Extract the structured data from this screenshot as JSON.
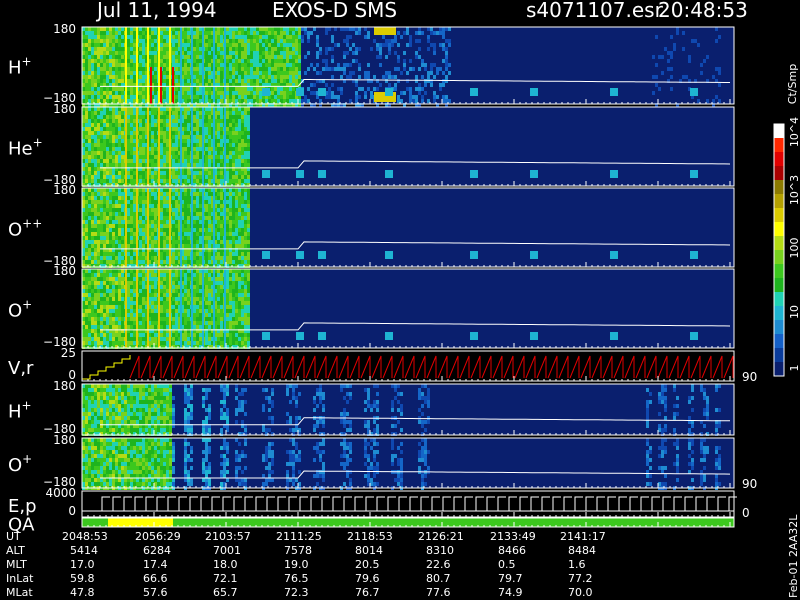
{
  "header": {
    "date": "Jul 11, 1994",
    "instrument": "EXOS-D SMS",
    "file": "s4071107.esr",
    "time": "20:48:53"
  },
  "colorbar": {
    "unit_label": "Ct/Smp",
    "tick_labels": [
      "1",
      "10",
      "100",
      "10^3",
      "10^4"
    ],
    "colors": [
      "#0a1f6e",
      "#0a3c9c",
      "#1460c8",
      "#1e8cd2",
      "#1eb4d2",
      "#20d2b4",
      "#1eb41e",
      "#3cc81e",
      "#78d21e",
      "#b4dc14",
      "#ffff00",
      "#dccc00",
      "#b4a000",
      "#8c7a00",
      "#aa0000",
      "#e10000",
      "#ff2800",
      "#ffffff"
    ]
  },
  "panels": [
    {
      "label": "H",
      "sup": "+",
      "ymax_label": "180",
      "ymin_label": "−180"
    },
    {
      "label": "He",
      "sup": "+",
      "ymax_label": "180",
      "ymin_label": "−180"
    },
    {
      "label": "O",
      "sup": "++",
      "ymax_label": "180",
      "ymin_label": "−180"
    },
    {
      "label": "O",
      "sup": "+",
      "ymax_label": "180",
      "ymin_label": "−180"
    },
    {
      "label": "V,r",
      "sup": "",
      "ymax_label": "25",
      "ymin_label": "0",
      "right_label": "90"
    },
    {
      "label": "H",
      "sup": "+",
      "ymax_label": "180",
      "ymin_label": "−180"
    },
    {
      "label": "O",
      "sup": "+",
      "ymax_label": "180",
      "ymin_label": "−180",
      "right_label": "90"
    },
    {
      "label": "E,p",
      "sup": "",
      "ymax_label": "4000",
      "ymin_label": "0",
      "right_label": "0"
    },
    {
      "label": "QA",
      "sup": "",
      "ymax_label": "",
      "ymin_label": ""
    }
  ],
  "chart_data": {
    "type": "heatmap",
    "x": [
      "2048:53",
      "2056:29",
      "2103:57",
      "2111:25",
      "2118:53",
      "2126:21",
      "2133:49",
      "2141:17"
    ],
    "table": {
      "rows": [
        {
          "name": "UT",
          "values": [
            "2048:53",
            "2056:29",
            "2103:57",
            "2111:25",
            "2118:53",
            "2126:21",
            "2133:49",
            "2141:17"
          ]
        },
        {
          "name": "ALT",
          "values": [
            "5414",
            "6284",
            "7001",
            "7578",
            "8014",
            "8310",
            "8466",
            "8484"
          ]
        },
        {
          "name": "MLT",
          "values": [
            "17.0",
            "17.4",
            "18.0",
            "19.0",
            "20.5",
            "22.6",
            "0.5",
            "1.6"
          ]
        },
        {
          "name": "InLat",
          "values": [
            "59.8",
            "66.6",
            "72.1",
            "76.5",
            "79.6",
            "80.7",
            "79.7",
            "77.2"
          ]
        },
        {
          "name": "MLat",
          "values": [
            "47.8",
            "57.6",
            "65.7",
            "72.3",
            "76.7",
            "77.6",
            "74.9",
            "70.0"
          ]
        }
      ]
    },
    "footer_note": "Feb-01 2AA32L"
  }
}
